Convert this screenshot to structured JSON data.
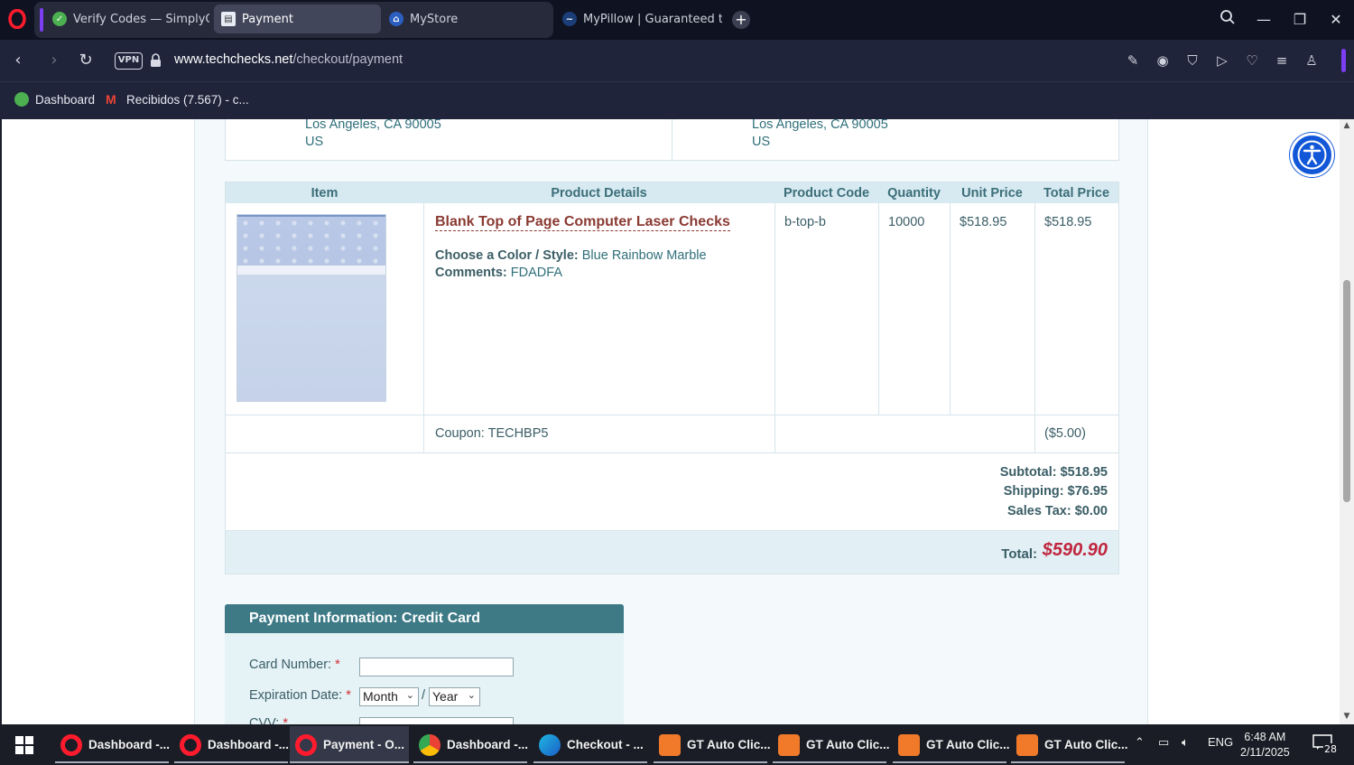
{
  "browser": {
    "tabs": [
      {
        "title": "Verify Codes — SimplyCodes",
        "favicon": "simplycodes-icon",
        "active": false
      },
      {
        "title": "Payment",
        "favicon": "page-icon",
        "active": true
      },
      {
        "title": "MyStore",
        "favicon": "store-icon",
        "active": false
      },
      {
        "title": "MyPillow | Guaranteed the",
        "favicon": "mypillow-icon",
        "active": false
      }
    ],
    "new_tab": "+",
    "url_host": "www.techchecks.net",
    "url_path": "/checkout/payment",
    "vpn_label": "VPN",
    "bookmarks": [
      {
        "label": "Dashboard",
        "icon": "simplycodes-icon"
      },
      {
        "label": "Recibidos (7.567) - c...",
        "icon": "gmail-icon"
      }
    ]
  },
  "addresses": {
    "left": {
      "city_line": "Los Angeles, CA 90005",
      "country": "US"
    },
    "right": {
      "city_line": "Los Angeles, CA 90005",
      "country": "US"
    }
  },
  "order": {
    "headers": {
      "item": "Item",
      "details": "Product Details",
      "code": "Product Code",
      "qty": "Quantity",
      "unit": "Unit Price",
      "total": "Total Price"
    },
    "product": {
      "name": "Blank Top of Page Computer Laser Checks",
      "color_label": "Choose a Color / Style:",
      "color_value": "Blue Rainbow Marble",
      "comments_label": "Comments:",
      "comments_value": "FDADFA",
      "code": "b-top-b",
      "quantity": "10000",
      "unit_price": "$518.95",
      "total_price": "$518.95"
    },
    "coupon": {
      "label": "Coupon: TECHBP5",
      "amount": "($5.00)"
    },
    "subtotal": "Subtotal: $518.95",
    "shipping": "Shipping: $76.95",
    "sales_tax": "Sales Tax: $0.00",
    "total_label": "Total:",
    "total_value": "$590.90"
  },
  "payment": {
    "title": "Payment Information: Credit Card",
    "card_number_label": "Card Number:",
    "expiration_label": "Expiration Date:",
    "required_mark": "*",
    "month_value": "Month",
    "year_value": "Year",
    "separator": "/",
    "cvv_label": "CVV:"
  },
  "taskbar": {
    "tasks": [
      {
        "label": "Dashboard -...",
        "icon": "opera-icon"
      },
      {
        "label": "Dashboard -...",
        "icon": "opera-icon"
      },
      {
        "label": "Payment - O...",
        "icon": "opera-icon",
        "active": true
      },
      {
        "label": "Dashboard -...",
        "icon": "chrome-icon"
      },
      {
        "label": "Checkout - ...",
        "icon": "edge-icon"
      },
      {
        "label": "GT Auto Clic...",
        "icon": "autoclicker-icon"
      },
      {
        "label": "GT Auto Clic...",
        "icon": "autoclicker-icon"
      },
      {
        "label": "GT Auto Clic...",
        "icon": "autoclicker-icon"
      },
      {
        "label": "GT Auto Clic...",
        "icon": "autoclicker-icon"
      }
    ],
    "language": "ENG",
    "time": "6:48 AM",
    "date": "2/11/2025",
    "notifications": "28"
  },
  "colors": {
    "accent": "#3d7a86",
    "link": "#8a3a32",
    "total": "#c0263e",
    "opera_purple": "#7b3ef2"
  }
}
